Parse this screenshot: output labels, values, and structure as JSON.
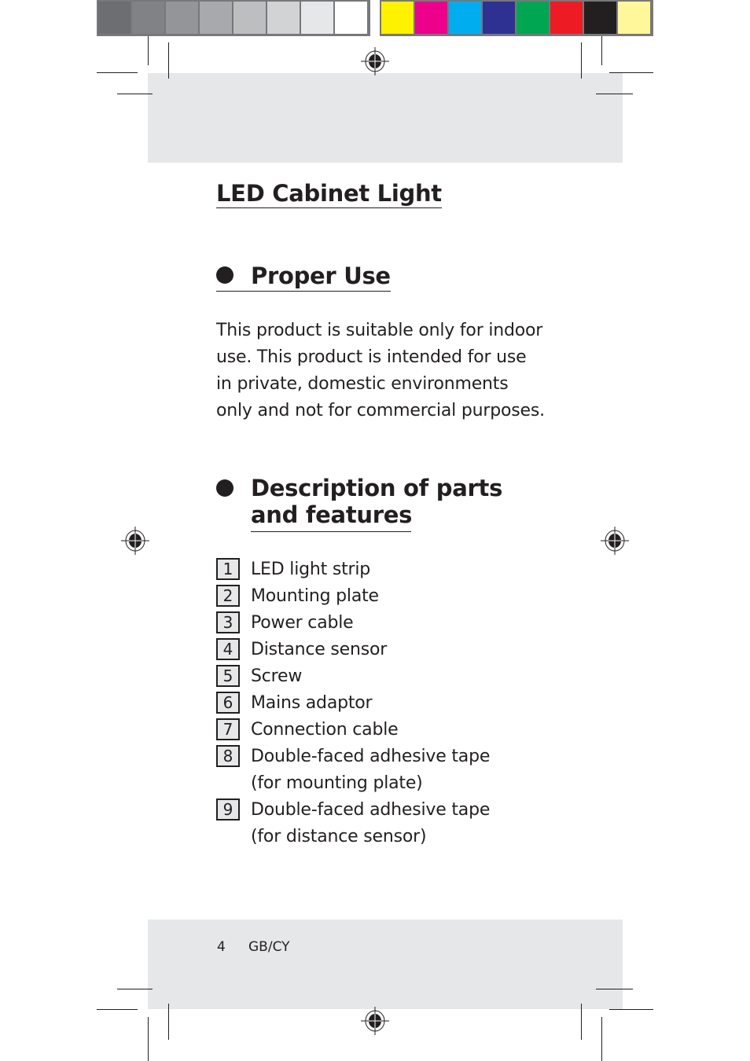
{
  "print_marks": {
    "grayscale_swatches": [
      "#6d6e71",
      "#808285",
      "#939598",
      "#a7a9ac",
      "#bcbec0",
      "#d1d3d4",
      "#e6e7e8",
      "#ffffff"
    ],
    "color_swatches": [
      "#fff200",
      "#ec008c",
      "#00aeef",
      "#2e3192",
      "#00a651",
      "#ed1c24",
      "#231f20",
      "#fff799"
    ]
  },
  "colors": {
    "text": "#231f20",
    "band": "#e6e7e8",
    "number_box_fill": "#e6e7e8"
  },
  "document": {
    "title": "LED Cabinet Light",
    "sections": [
      {
        "heading": "Proper Use",
        "body": "This product is suitable only for indoor use. This product is intended for use in private, domestic environments only and not for commercial purposes."
      },
      {
        "heading_line1": "Description of parts",
        "heading_line2": "and features",
        "parts": [
          {
            "num": "1",
            "label": "LED light strip"
          },
          {
            "num": "2",
            "label": "Mounting plate"
          },
          {
            "num": "3",
            "label": "Power cable"
          },
          {
            "num": "4",
            "label": "Distance sensor"
          },
          {
            "num": "5",
            "label": "Screw"
          },
          {
            "num": "6",
            "label": "Mains adaptor"
          },
          {
            "num": "7",
            "label": "Connection cable"
          },
          {
            "num": "8",
            "label": "Double-faced adhesive tape",
            "label2": "(for mounting plate)"
          },
          {
            "num": "9",
            "label": "Double-faced adhesive tape",
            "label2": "(for distance sensor)"
          }
        ]
      }
    ]
  },
  "footer": {
    "page_number": "4",
    "language_code": "GB/CY"
  }
}
